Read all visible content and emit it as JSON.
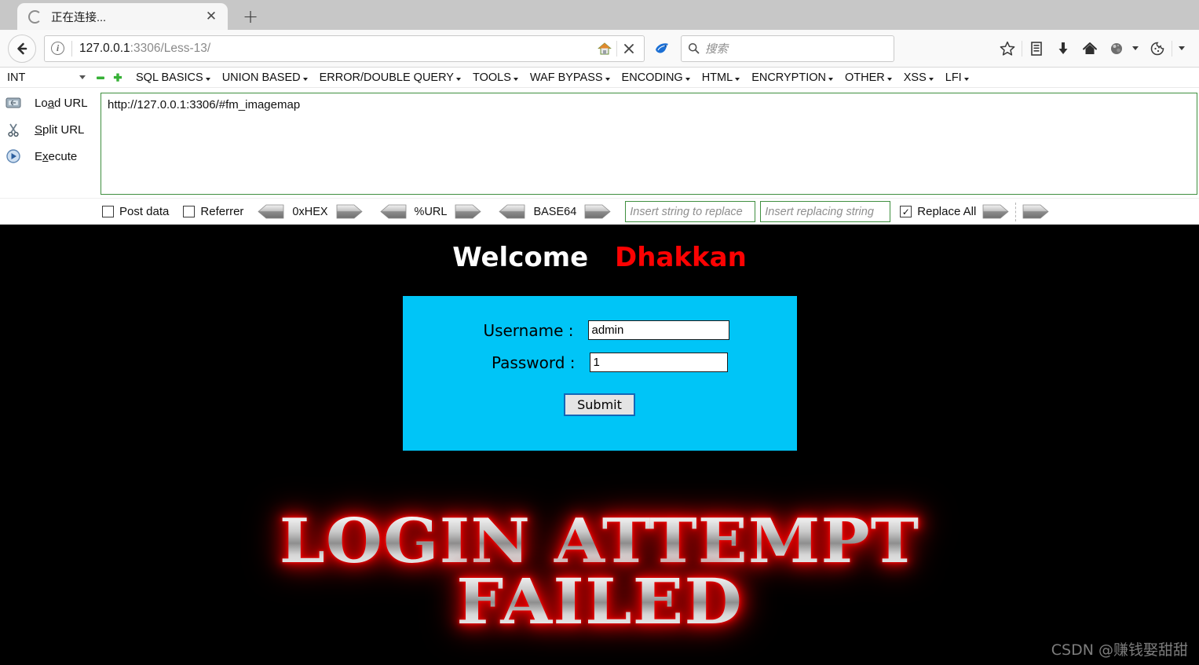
{
  "browser": {
    "tab": {
      "title": "正在连接...",
      "spinner_icon": "loading-spinner-icon",
      "close_icon": "close-icon"
    },
    "new_tab_label": "+",
    "back_icon": "back-arrow-icon",
    "identity_icon": "info-icon",
    "url": {
      "host": "127.0.0.1",
      "path": ":3306/Less-13/"
    },
    "url_icons": [
      "home-icon",
      "stop-icon"
    ],
    "reader_icon": "bird-icon",
    "search": {
      "icon": "search-icon",
      "placeholder": "搜索"
    },
    "right_icons": [
      "star-icon",
      "library-icon",
      "download-icon",
      "home-icon",
      "globe-icon",
      "cookie-icon",
      "chevron-down-icon"
    ]
  },
  "hackbar": {
    "type_select": {
      "value": "INT",
      "icon": "chevron-down-icon"
    },
    "minus_icon": "minus-icon",
    "plus_icon": "plus-icon",
    "menus": [
      "SQL BASICS",
      "UNION BASED",
      "ERROR/DOUBLE QUERY",
      "TOOLS",
      "WAF BYPASS",
      "ENCODING",
      "HTML",
      "ENCRYPTION",
      "OTHER",
      "XSS",
      "LFI"
    ],
    "side_buttons": [
      {
        "label": "Load URL",
        "accel": "a",
        "icon": "load-url-icon"
      },
      {
        "label": "Split URL",
        "accel": "p",
        "icon": "scissors-icon"
      },
      {
        "label": "Execute",
        "accel": "x",
        "icon": "play-icon"
      }
    ],
    "textarea_value": "http://127.0.0.1:3306/#fm_imagemap",
    "footer": {
      "post_data": {
        "label": "Post data",
        "checked": false
      },
      "referrer": {
        "label": "Referrer",
        "checked": false
      },
      "converters": [
        "0xHEX",
        "%URL",
        "BASE64"
      ],
      "replace_from_placeholder": "Insert string to replace",
      "replace_to_placeholder": "Insert replacing string",
      "replace_all": {
        "label": "Replace All",
        "checked": true,
        "mark": "✓"
      }
    }
  },
  "page": {
    "welcome_text": "Welcome",
    "welcome_name": "Dhakkan",
    "form": {
      "username_label": "Username :",
      "username_value": "admin",
      "password_label": "Password :",
      "password_value": "1",
      "submit_label": "Submit"
    },
    "fail_line1": "LOGIN ATTEMPT",
    "fail_line2": "FAILED",
    "watermark": "CSDN @赚钱娶甜甜"
  },
  "colors": {
    "form_panel": "#00c5f7",
    "page_bg": "#000000",
    "name_red": "#fb0202",
    "hackbar_border_green": "#3f8f3f"
  }
}
